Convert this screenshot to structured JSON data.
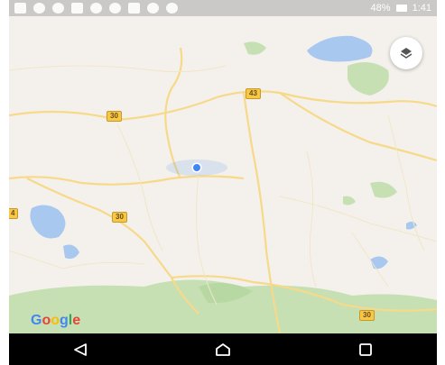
{
  "status_bar": {
    "battery_text": "48%",
    "time": "1:41"
  },
  "map": {
    "road_labels": [
      "43",
      "30",
      "30",
      "30",
      "4"
    ],
    "attribution": [
      "G",
      "o",
      "o",
      "g",
      "l",
      "e"
    ],
    "colors": {
      "land": "#f4f1ec",
      "road": "#f7d98a",
      "water": "#a9c8ef",
      "park": "#c6e0b4",
      "location": "#4285f4"
    }
  },
  "controls": {
    "layers_icon": "layers-icon"
  },
  "navigation": {
    "back_icon": "back-triangle-icon",
    "home_icon": "home-icon",
    "recents_icon": "recents-square-icon"
  }
}
